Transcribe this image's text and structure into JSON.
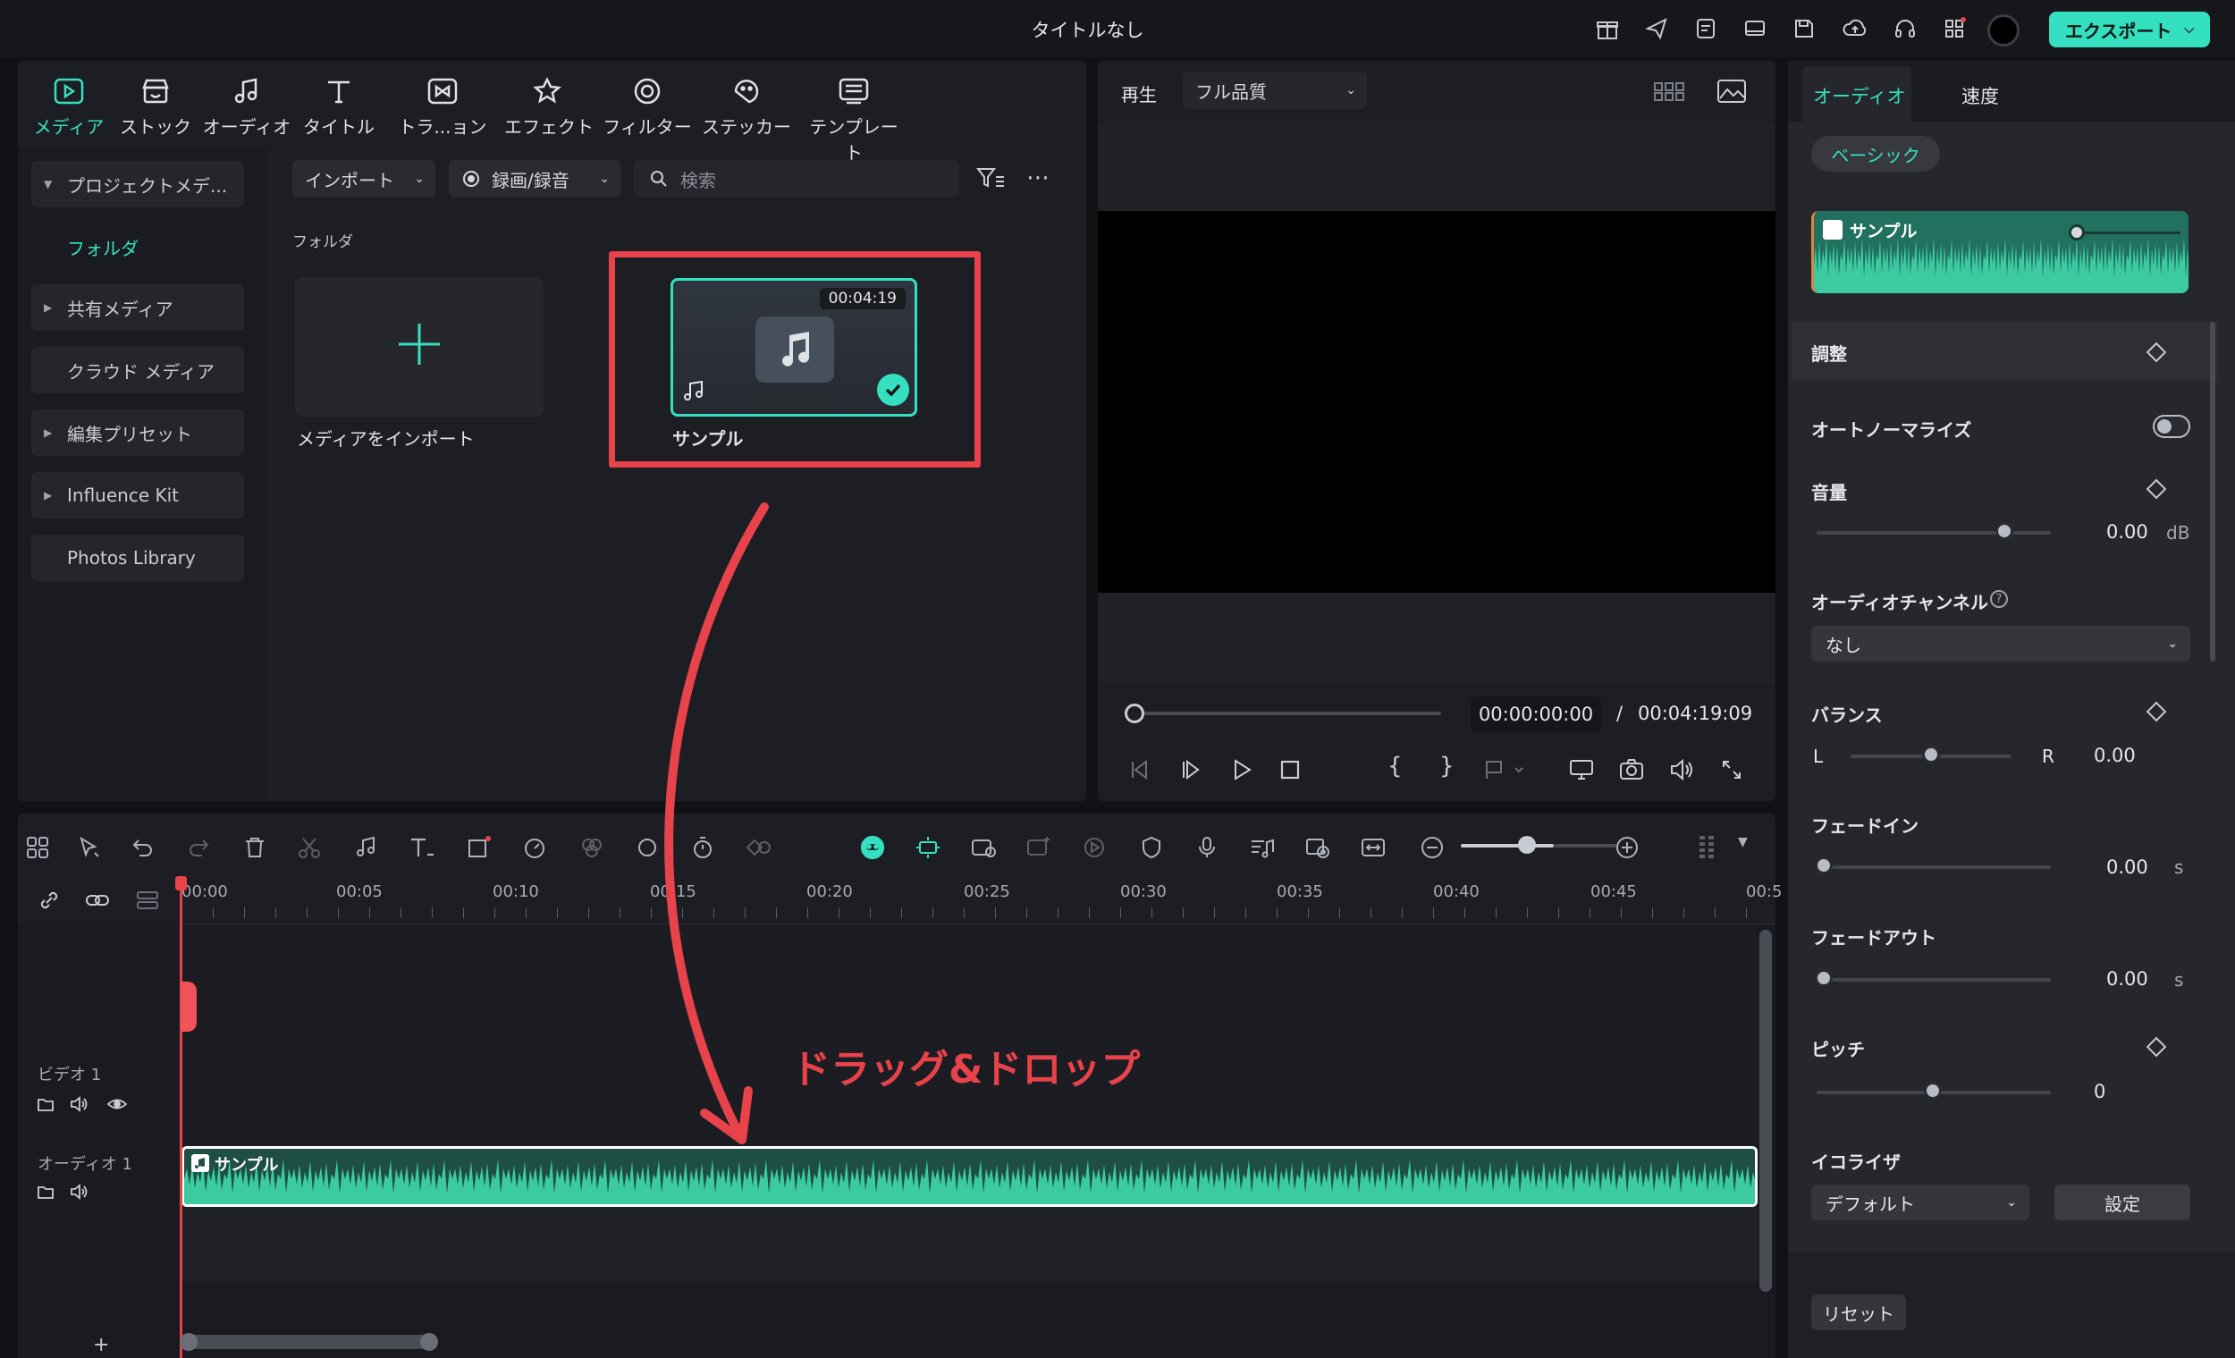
{
  "app": {
    "title": "タイトルなし",
    "export_label": "エクスポート"
  },
  "toolbar": {
    "items": [
      {
        "label": "メディア",
        "icon": "media-icon"
      },
      {
        "label": "ストック",
        "icon": "stock-icon"
      },
      {
        "label": "オーディオ",
        "icon": "audio-icon"
      },
      {
        "label": "タイトル",
        "icon": "title-icon"
      },
      {
        "label": "トラ...ョン",
        "icon": "transition-icon"
      },
      {
        "label": "エフェクト",
        "icon": "effect-icon"
      },
      {
        "label": "フィルター",
        "icon": "filter-icon"
      },
      {
        "label": "ステッカー",
        "icon": "sticker-icon"
      },
      {
        "label": "テンプレート",
        "icon": "template-icon"
      }
    ]
  },
  "sidebar": {
    "project_media": "プロジェクトメデ...",
    "folder": "フォルダ",
    "shared_media": "共有メディア",
    "cloud_media": "クラウド メディア",
    "edit_presets": "編集プリセット",
    "influence_kit": "Influence Kit",
    "photos_library": "Photos Library"
  },
  "media": {
    "import_label": "インポート",
    "record_label": "録画/録音",
    "search_placeholder": "検索",
    "folder_heading": "フォルダ",
    "import_tile_caption": "メディアをインポート",
    "clip_duration": "00:04:19",
    "clip_name": "サンプル"
  },
  "preview": {
    "play_label": "再生",
    "quality": "フル品質",
    "current_time": "00:00:00:00",
    "separator": "/",
    "total_time": "00:04:19:09",
    "brace_open": "{",
    "brace_close": "}"
  },
  "timeline": {
    "ruler": [
      "00:00",
      "00:05",
      "00:10",
      "00:15",
      "00:20",
      "00:25",
      "00:30",
      "00:35",
      "00:40",
      "00:45",
      "00:5"
    ],
    "video_track": "ビデオ 1",
    "audio_track": "オーディオ 1",
    "audio_clip_name": "サンプル",
    "add": "+",
    "annotation": "ドラッグ&ドロップ"
  },
  "right_panel": {
    "tabs": [
      "オーディオ",
      "速度"
    ],
    "basic_chip": "ベーシック",
    "clip_name": "サンプル",
    "adjust": "調整",
    "auto_normalize": "オートノーマライズ",
    "volume": "音量",
    "volume_value": "0.00",
    "volume_unit": "dB",
    "audio_channel": "オーディオチャンネル",
    "channel_value": "なし",
    "balance": "バランス",
    "balance_left": "L",
    "balance_right": "R",
    "balance_value": "0.00",
    "fade_in": "フェードイン",
    "fade_in_value": "0.00",
    "fade_out": "フェードアウト",
    "fade_out_value": "0.00",
    "seconds_unit": "s",
    "pitch": "ピッチ",
    "pitch_value": "0",
    "equalizer": "イコライザ",
    "eq_value": "デフォルト",
    "settings_button": "設定",
    "reset_button": "リセット"
  },
  "colors": {
    "accent": "#35e0c1",
    "highlight": "#e8424b",
    "waveform": "#2fae8d"
  }
}
